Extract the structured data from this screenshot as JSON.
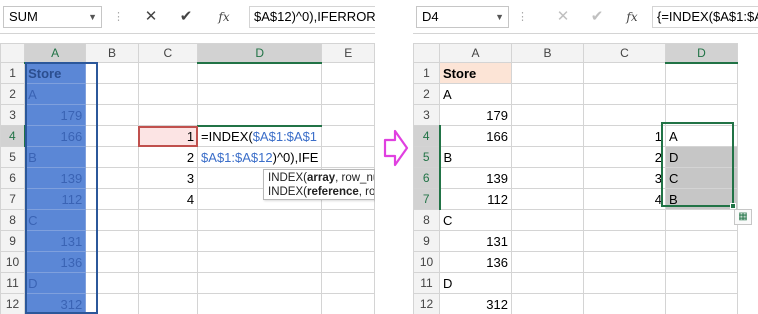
{
  "left": {
    "namebox": "SUM",
    "formula_text": "$A$12)^0),IFERROR(I",
    "columns": [
      "A",
      "B",
      "C",
      "D",
      "E"
    ],
    "rows": [
      "1",
      "2",
      "3",
      "4",
      "5",
      "6",
      "7",
      "8",
      "9",
      "10",
      "11",
      "12"
    ],
    "colA": [
      "Store",
      "A",
      "179",
      "166",
      "B",
      "139",
      "112",
      "C",
      "131",
      "136",
      "D",
      "312"
    ],
    "colC": [
      "",
      "",
      "",
      "1",
      "2",
      "3",
      "4",
      "",
      "",
      "",
      "",
      ""
    ],
    "edit_line1_prefix": "=INDEX(",
    "edit_line1_ref": "$A$1:$A$1",
    "edit_line2_ref": "$A$1:$A$12",
    "edit_line2_rest": ")^0),IFE",
    "tooltip_line1_fn": "INDEX(",
    "tooltip_line1_arg": "array",
    "tooltip_line1_rest": ", row_nu",
    "tooltip_line2_fn": "INDEX(",
    "tooltip_line2_arg": "reference",
    "tooltip_line2_rest": ", ro"
  },
  "right": {
    "namebox": "D4",
    "formula_text": "{=INDEX($A$1:$A$",
    "columns": [
      "A",
      "B",
      "C",
      "D"
    ],
    "rows": [
      "1",
      "2",
      "3",
      "4",
      "5",
      "6",
      "7",
      "8",
      "9",
      "10",
      "11",
      "12"
    ],
    "colA": [
      "Store",
      "A",
      "179",
      "166",
      "B",
      "139",
      "112",
      "C",
      "131",
      "136",
      "D",
      "312"
    ],
    "colC": [
      "",
      "",
      "",
      "1",
      "2",
      "3",
      "4",
      "",
      "",
      "",
      "",
      ""
    ],
    "colD": [
      "",
      "",
      "",
      "A",
      "D",
      "C",
      "B",
      "",
      "",
      "",
      "",
      ""
    ]
  },
  "colors": {
    "header_fill": "#fce4d6",
    "selection_green": "#217346",
    "selection_blue": "#5b87d6",
    "arrow": "#e040e0",
    "error_red": "#c0504d"
  }
}
